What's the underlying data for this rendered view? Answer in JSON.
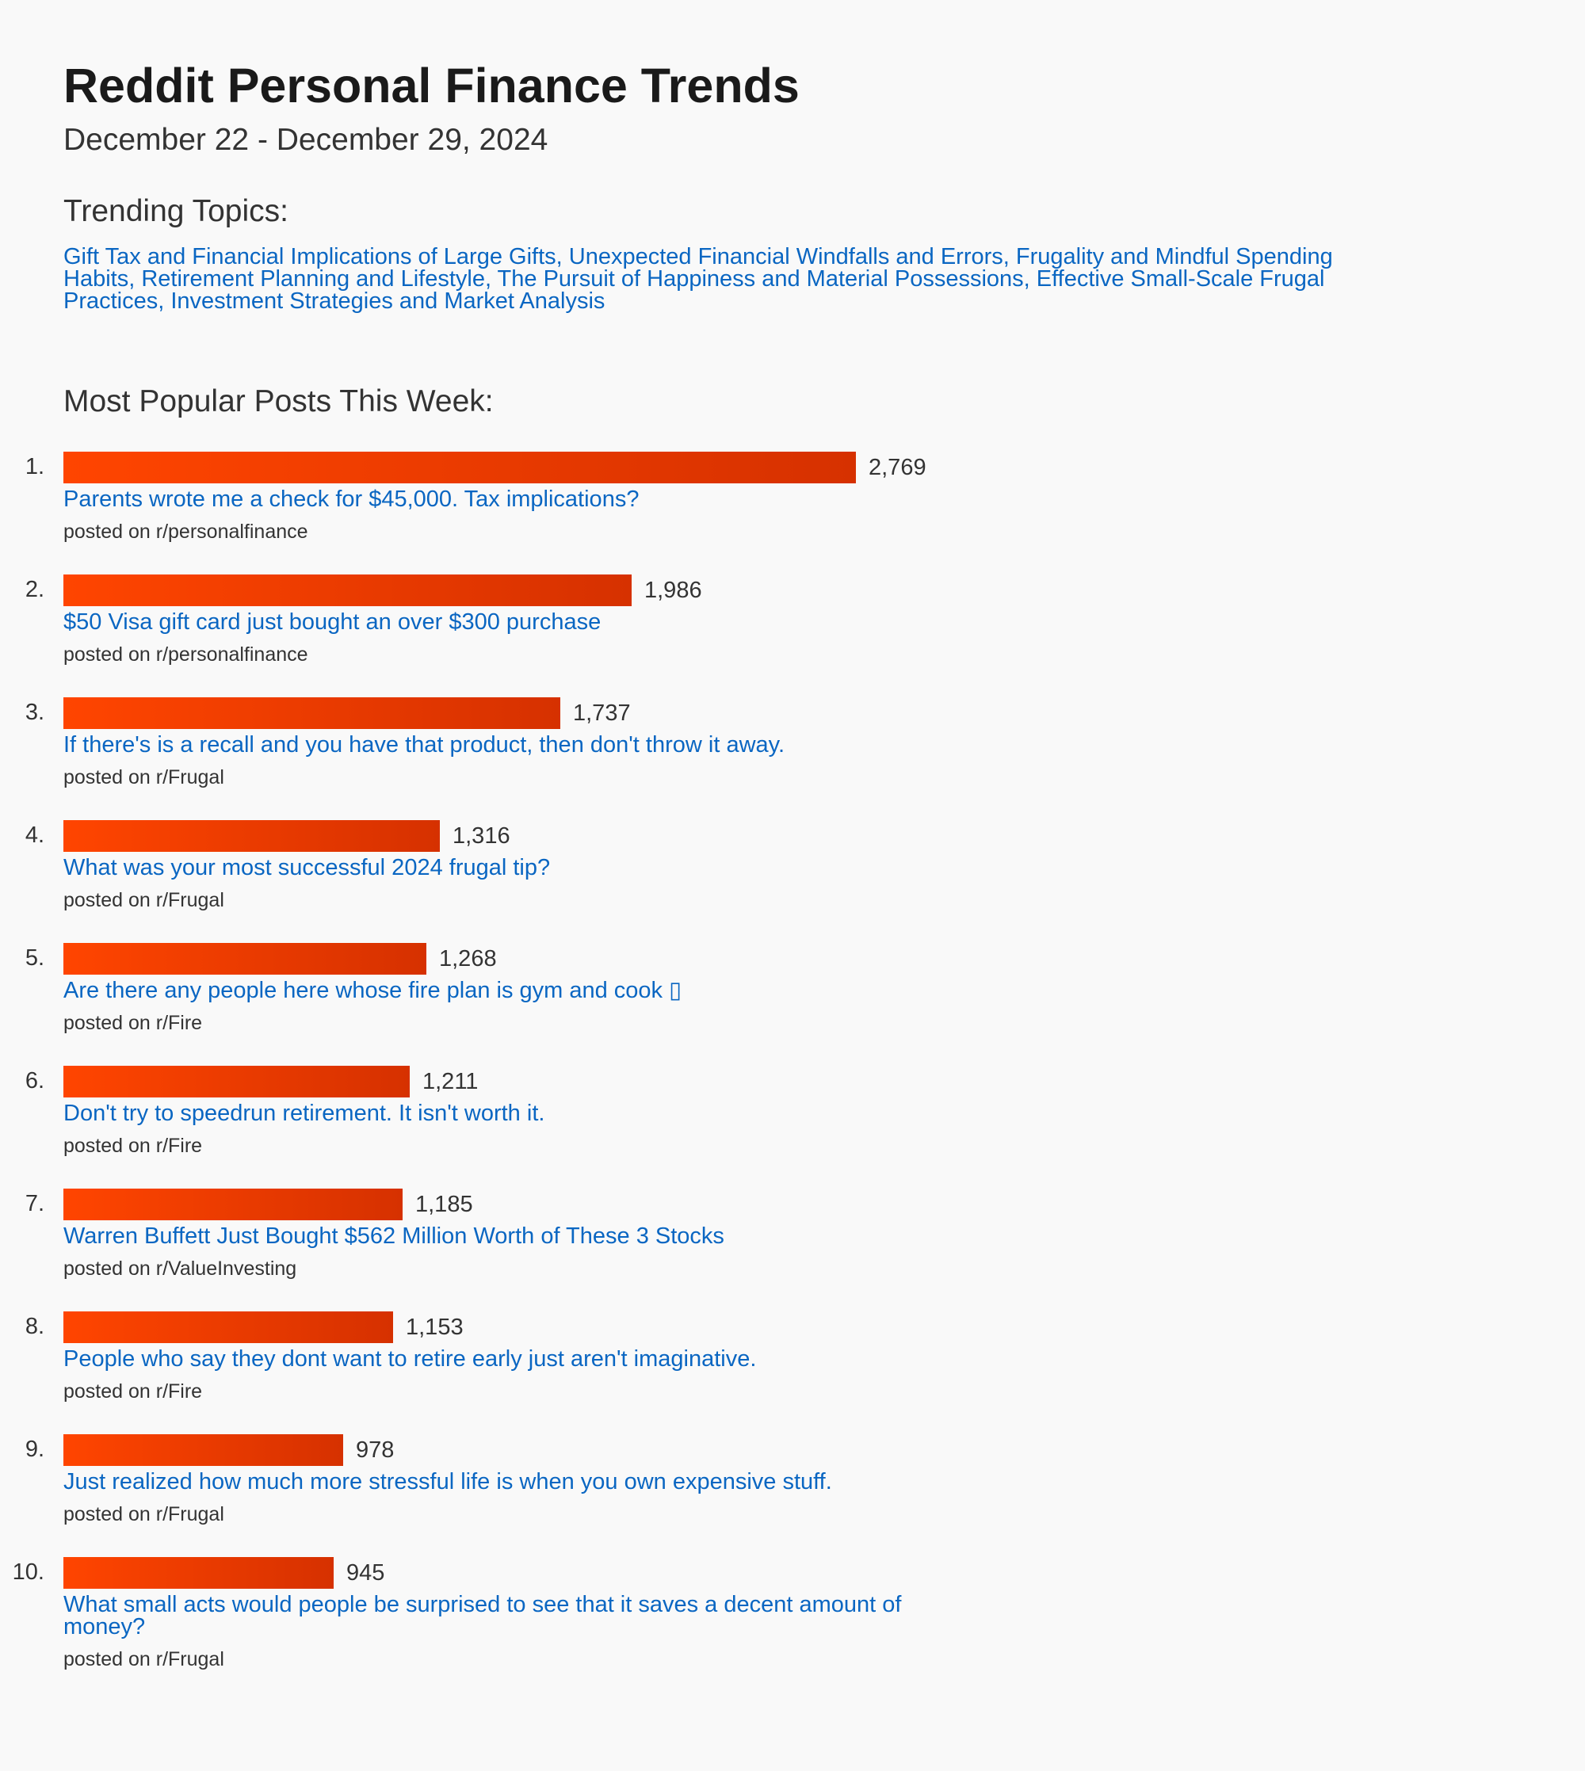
{
  "header": {
    "title": "Reddit Personal Finance Trends",
    "date_range": "December 22 - December 29, 2024"
  },
  "topics": {
    "heading": "Trending Topics:",
    "text": "Gift Tax and Financial Implications of Large Gifts, Unexpected Financial Windfalls and Errors, Frugality and Mindful Spending Habits, Retirement Planning and Lifestyle, The Pursuit of Happiness and Material Possessions, Effective Small-Scale Frugal Practices, Investment Strategies and Market Analysis"
  },
  "posts_section": {
    "heading": "Most Popular Posts This Week:"
  },
  "bar_scale": {
    "max_value": 2769
  },
  "colors": {
    "bar_start": "#ff4500",
    "bar_end": "#d63100",
    "link": "#0a66c2"
  },
  "posts": [
    {
      "rank": "1.",
      "score": 2769,
      "score_label": "2,769",
      "title": "Parents wrote me a check for $45,000. Tax implications?",
      "meta": "posted on r/personalfinance"
    },
    {
      "rank": "2.",
      "score": 1986,
      "score_label": "1,986",
      "title": "$50 Visa gift card just bought an over $300 purchase",
      "meta": "posted on r/personalfinance"
    },
    {
      "rank": "3.",
      "score": 1737,
      "score_label": "1,737",
      "title": "If there's is a recall and you have that product, then don't throw it away.",
      "meta": "posted on r/Frugal"
    },
    {
      "rank": "4.",
      "score": 1316,
      "score_label": "1,316",
      "title": "What was your most successful 2024 frugal tip?",
      "meta": "posted on r/Frugal"
    },
    {
      "rank": "5.",
      "score": 1268,
      "score_label": "1,268",
      "title": "Are there any people here whose fire plan is gym and cook ▯",
      "meta": "posted on r/Fire"
    },
    {
      "rank": "6.",
      "score": 1211,
      "score_label": "1,211",
      "title": "Don't try to speedrun retirement. It isn't worth it.",
      "meta": "posted on r/Fire"
    },
    {
      "rank": "7.",
      "score": 1185,
      "score_label": "1,185",
      "title": "Warren Buffett Just Bought $562 Million Worth of These 3 Stocks",
      "meta": "posted on r/ValueInvesting"
    },
    {
      "rank": "8.",
      "score": 1153,
      "score_label": "1,153",
      "title": "People who say they dont want to retire early just aren't imaginative.",
      "meta": "posted on r/Fire"
    },
    {
      "rank": "9.",
      "score": 978,
      "score_label": "978",
      "title": "Just realized how much more stressful life is when you own expensive stuff.",
      "meta": "posted on r/Frugal"
    },
    {
      "rank": "10.",
      "score": 945,
      "score_label": "945",
      "title": "What small acts would people be surprised to see that it saves a decent amount of money?",
      "meta": "posted on r/Frugal"
    }
  ]
}
